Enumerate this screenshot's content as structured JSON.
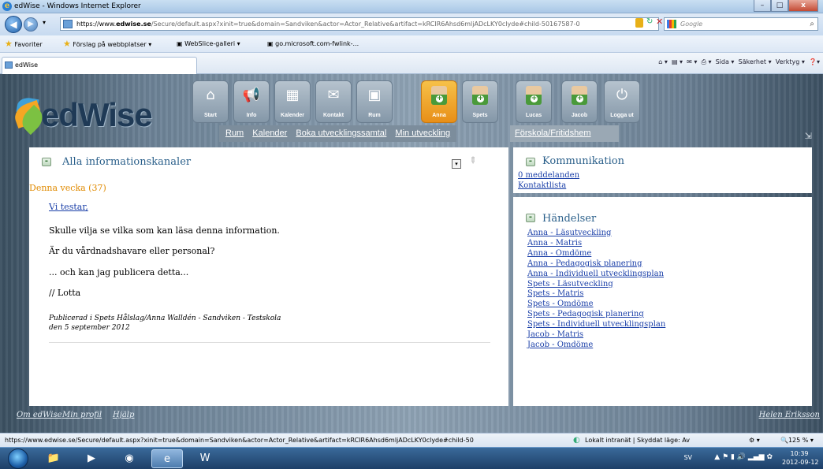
{
  "window": {
    "title": "edWise - Windows Internet Explorer",
    "min": "–",
    "max": "□",
    "close": "x"
  },
  "address": {
    "url_prefix": "https://www.",
    "url_domain": "edwise.se",
    "url_rest": "/Secure/default.aspx?xinit=true&domain=Sandviken&actor=Actor_Relative&artifact=kRCIR6Ahsd6mljADcLKY0clyde#child-50167587-0",
    "search_placeholder": "Google"
  },
  "favorites": {
    "label": "Favoriter",
    "items": [
      "Förslag på webbplatser ▾",
      "WebSlice-galleri ▾",
      "go.microsoft.com-fwlink-..."
    ]
  },
  "tab": {
    "label": "edWise"
  },
  "commandbar": {
    "page": "Sida ▾",
    "safety": "Säkerhet ▾",
    "tools": "Verktyg ▾"
  },
  "site": {
    "logo": "edWise",
    "nav": [
      {
        "label": "Start",
        "icon": "home-icon"
      },
      {
        "label": "Info",
        "icon": "megaphone-icon"
      },
      {
        "label": "Kalender",
        "icon": "calendar-icon"
      },
      {
        "label": "Kontakt",
        "icon": "envelope-icon"
      },
      {
        "label": "Rum",
        "icon": "box-icon"
      },
      {
        "label": "Anna",
        "icon": "child-avatar-icon"
      },
      {
        "label": "Spets",
        "icon": "child-avatar-icon"
      },
      {
        "label": "Lucas",
        "icon": "child-avatar-icon"
      },
      {
        "label": "Jacob",
        "icon": "child-avatar-icon"
      },
      {
        "label": "Logga ut",
        "icon": "power-icon"
      }
    ],
    "active_nav": "Anna",
    "subnav": [
      "Rum",
      "Kalender",
      "Boka utvecklingssamtal",
      "Min utveckling"
    ],
    "subnav_extra": "Förskola/Fritidshem"
  },
  "main_panel": {
    "title": "Alla informationskanaler",
    "week": "Denna vecka (37)",
    "post_title": "Vi testar,",
    "lines": [
      "Skulle vilja se vilka som kan läsa denna information.",
      "Är du vårdnadshavare eller personal?",
      "... och kan jag publicera detta...",
      "// Lotta"
    ],
    "published_by": "Publicerad i Spets Hålslag/Anna Walldén - Sandviken - Testskola",
    "published_date": "den 5 september 2012"
  },
  "kommunikation": {
    "title": "Kommunikation",
    "messages": "0 meddelanden",
    "contacts": "Kontaktlista"
  },
  "handelser": {
    "title": "Händelser",
    "items": [
      "Anna - Läsutveckling",
      "Anna - Matris",
      "Anna - Omdöme",
      "Anna - Pedagogisk planering",
      "Anna - Individuell utvecklingsplan",
      "Spets - Läsutveckling",
      "Spets - Matris",
      "Spets - Omdöme",
      "Spets - Pedagogisk planering",
      "Spets - Individuell utvecklingsplan",
      "Jacob - Matris",
      "Jacob - Omdöme"
    ]
  },
  "footer": {
    "about": "Om edWise",
    "profile": "Min profil",
    "help": "Hjälp",
    "user": "Helen Eriksson"
  },
  "status": {
    "url": "https://www.edwise.se/Secure/default.aspx?xinit=true&domain=Sandviken&actor=Actor_Relative&artifact=kRCIR6Ahsd6mljADcLKY0clyde#child-50",
    "zone": "Lokalt intranät | Skyddat läge: Av",
    "zoom": "125 %"
  },
  "taskbar": {
    "lang": "SV",
    "time": "10:39",
    "date": "2012-09-12"
  }
}
